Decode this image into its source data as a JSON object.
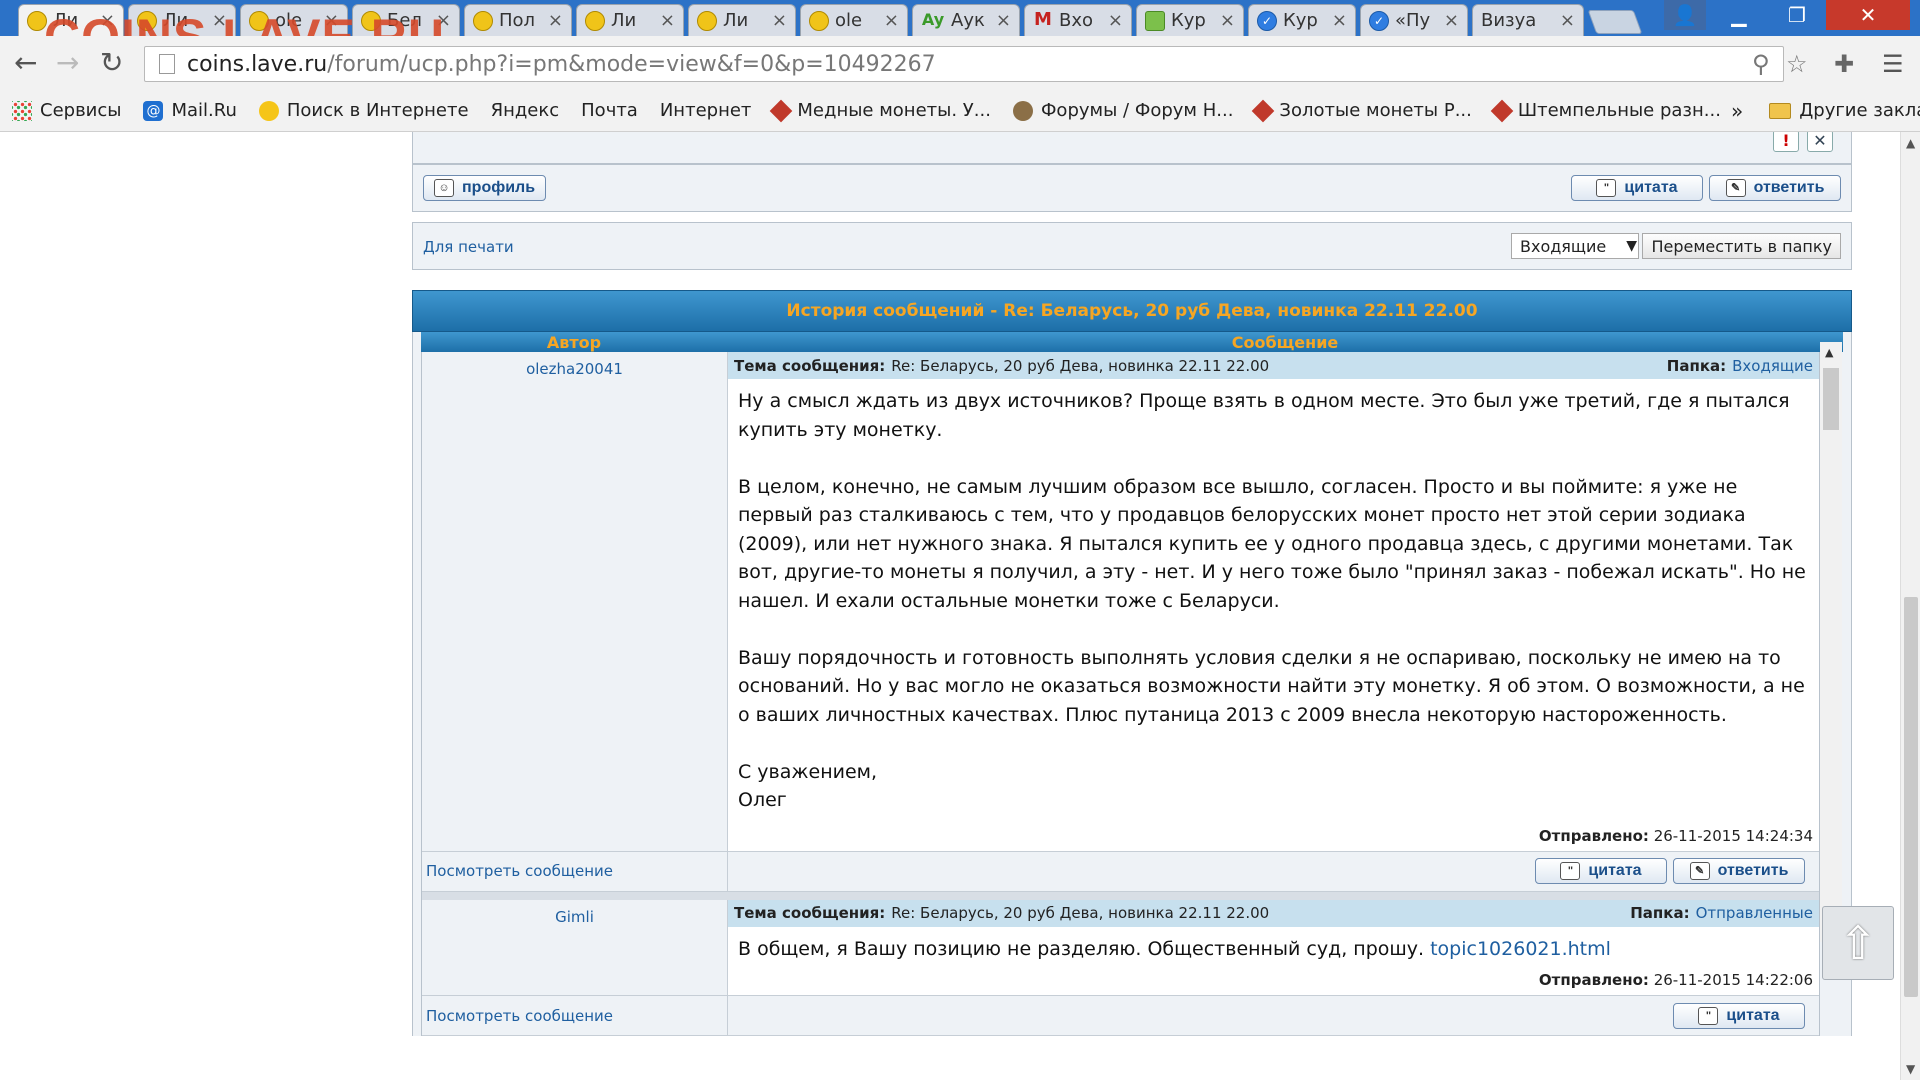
{
  "browser": {
    "watermark": "COINS.LAVE.RU",
    "tabs": [
      {
        "title": "Ли",
        "active": true
      },
      {
        "title": "Ли"
      },
      {
        "title": "ole"
      },
      {
        "title": "Бел"
      },
      {
        "title": "Пол"
      },
      {
        "title": "Ли"
      },
      {
        "title": "Ли"
      },
      {
        "title": "ole"
      },
      {
        "title": "Аук"
      },
      {
        "title": "Вхо"
      },
      {
        "title": "Кур"
      },
      {
        "title": "Кур"
      },
      {
        "title": "«Пу"
      },
      {
        "title": "Визуа"
      }
    ],
    "tab_close": "×",
    "url_host": "coins.lave.ru",
    "url_path": "/forum/ucp.php?i=pm&mode=view&f=0&p=10492267",
    "bookmarks": [
      {
        "label": "Сервисы",
        "icon": "apps-grid-icon"
      },
      {
        "label": "Mail.Ru",
        "icon": "mailru-icon"
      },
      {
        "label": "Поиск в Интернете",
        "icon": "search-icon"
      },
      {
        "label": "Яндекс",
        "icon": "page-icon"
      },
      {
        "label": "Почта",
        "icon": "page-icon"
      },
      {
        "label": "Интернет",
        "icon": "page-icon"
      },
      {
        "label": "Медные монеты. У...",
        "icon": "coin-site-icon"
      },
      {
        "label": "Форумы / Форум Н...",
        "icon": "forum-icon"
      },
      {
        "label": "Золотые монеты Р...",
        "icon": "coin-site-icon"
      },
      {
        "label": "Штемпельные разн...",
        "icon": "coin-site-icon"
      }
    ],
    "bookmarks_more": "»",
    "other_bookmarks": "Другие закладки"
  },
  "page": {
    "profile_button": "профиль",
    "quote_button": "цитата",
    "reply_button": "ответить",
    "print_link": "Для печати",
    "folder_select": "Входящие",
    "move_button": "Переместить в папку",
    "history_title": "История сообщений - Re: Беларусь, 20 руб Дева, новинка 22.11 22.00",
    "col_author": "Автор",
    "col_message": "Сообщение",
    "subject_label": "Тема сообщения:",
    "folder_label": "Папка:",
    "sent_label": "Отправлено:",
    "view_message": "Посмотреть сообщение",
    "messages": [
      {
        "author": "olezha20041",
        "subject": "Re: Беларусь, 20 руб Дева, новинка 22.11 22.00",
        "folder": "Входящие",
        "paragraphs": [
          "Ну а смысл ждать из двух источников? Проще взять в одном месте. Это был уже третий, где я пытался купить эту монетку.",
          "В целом, конечно, не самым лучшим образом все вышло, согласен. Просто и вы поймите: я уже не первый раз сталкиваюсь с тем, что у продавцов белорусских монет просто нет этой серии зодиака (2009), или нет нужного знака. Я пытался купить ее у одного продавца здесь, с другими монетами. Так вот, другие-то монеты я получил, а эту - нет. И у него тоже было \"принял заказ - побежал искать\". Но не нашел. И ехали остальные монетки тоже с Беларуси.",
          "Вашу порядочность и готовность выполнять условия сделки я не оспариваю, поскольку не имею на то оснований. Но у вас могло не оказаться возможности найти эту монетку. Я об этом. О возможности, а не о ваших личностных качествах. Плюс путаница 2013 с 2009 внесла некоторую настороженность."
        ],
        "signoff_1": "С уважением,",
        "signoff_2": "Олег",
        "sent": "26-11-2015 14:24:34"
      },
      {
        "author": "Gimli",
        "subject": "Re: Беларусь, 20 руб Дева, новинка 22.11 22.00",
        "folder": "Отправленные",
        "text": "В общем, я Вашу позицию не разделяю. Общественный суд, прошу.",
        "link": "topic1026021.html",
        "sent": "26-11-2015 14:22:06"
      }
    ]
  }
}
